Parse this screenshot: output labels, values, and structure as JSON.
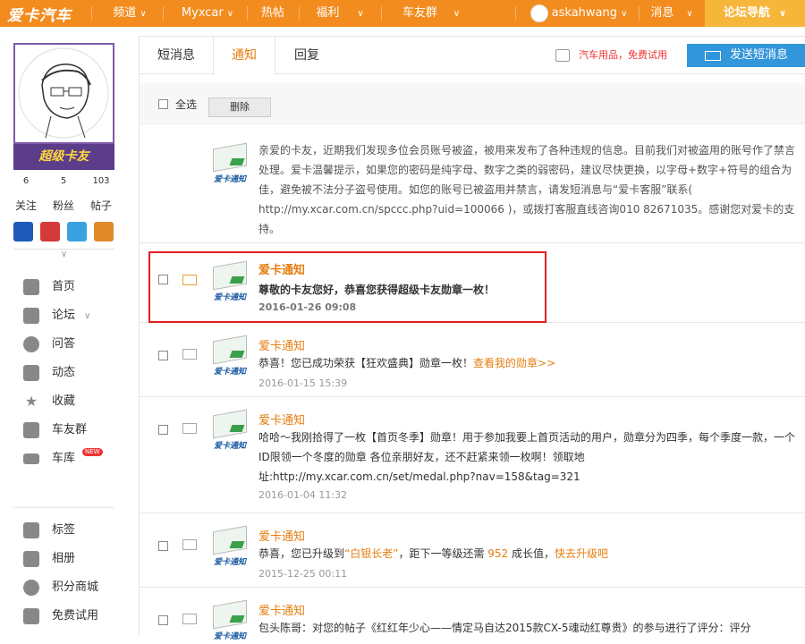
{
  "app": {
    "logo": "爱卡汽车"
  },
  "topnav": {
    "items": [
      {
        "label": "频道",
        "chev": "∨"
      },
      {
        "label": "Myxcar",
        "chev": "∨"
      },
      {
        "label": "热帖",
        "chev": ""
      },
      {
        "label": "福利",
        "chev": "∨"
      },
      {
        "label": "车友群",
        "chev": "∨"
      }
    ],
    "user": "askahwang",
    "user_chev": "∨",
    "messages": "消息",
    "messages_chev": "∨",
    "forum_nav": "论坛导航",
    "forum_nav_chev": "∨"
  },
  "profile": {
    "badge_text": "超级卡友",
    "stats": [
      {
        "value": "6",
        "label": "关注"
      },
      {
        "value": "5",
        "label": "粉丝"
      },
      {
        "value": "103",
        "label": "帖子"
      }
    ]
  },
  "sidebar": {
    "items": [
      {
        "label": "首页",
        "icon": "home-icon"
      },
      {
        "label": "论坛",
        "icon": "forum-icon",
        "sub": "∨"
      },
      {
        "label": "问答",
        "icon": "question-icon"
      },
      {
        "label": "动态",
        "icon": "activity-icon"
      },
      {
        "label": "收藏",
        "icon": "star-icon"
      },
      {
        "label": "车友群",
        "icon": "group-icon"
      },
      {
        "label": "车库",
        "icon": "car-icon",
        "badge": "NEW"
      },
      {
        "label": "标签",
        "icon": "tag-icon"
      },
      {
        "label": "相册",
        "icon": "camera-icon"
      },
      {
        "label": "积分商城",
        "icon": "coin-icon"
      },
      {
        "label": "免费试用",
        "icon": "gift-icon"
      }
    ]
  },
  "tabs": [
    {
      "label": "短消息"
    },
    {
      "label": "通知",
      "active": true
    },
    {
      "label": "回复"
    }
  ],
  "promo": "汽车用品，免费试用",
  "send_button": "发送短消息",
  "toolbar": {
    "select_all": "全选",
    "delete": "删除"
  },
  "messages": [
    {
      "sender": "",
      "icon_label": "爱卡通知",
      "text": "亲爱的卡友，近期我们发现多位会员账号被盗，被用来发布了各种违规的信息。目前我们对被盗用的账号作了禁言处理。爱卡温馨提示，如果您的密码是纯字母、数字之类的弱密码，建议尽快更换，以字母+数字+符号的组合为佳，避免被不法分子盗号使用。如您的账号已被盗用并禁言，请发短消息与“爱卡客服”联系( http://my.xcar.com.cn/spccc.php?uid=100066 )，或拨打客服直线咨询010 82671035。感谢您对爱卡的支持。",
      "date": "",
      "highlight": ""
    },
    {
      "sender": "爱卡通知",
      "icon_label": "爱卡通知",
      "text": "尊敬的卡友您好，恭喜您获得超级卡友勋章一枚！",
      "date": "2016-01-26 09:08",
      "highlight": ""
    },
    {
      "sender": "爱卡通知",
      "icon_label": "爱卡通知",
      "text": "恭喜！您已成功荣获【狂欢盛典】勋章一枚！",
      "highlight": "查看我的勋章>>",
      "date": "2016-01-15 15:39"
    },
    {
      "sender": "爱卡通知",
      "icon_label": "爱卡通知",
      "text": "哈哈～我刚拾得了一枚【首页冬季】勋章！用于参加我要上首页活动的用户，勋章分为四季，每个季度一款，一个ID限领一个冬度的勋章 各位亲朋好友，还不赶紧来领一枚啊！领取地址:http://my.xcar.com.cn/set/medal.php?nav=158&tag=321",
      "date": "2016-01-04 11:32",
      "highlight": ""
    },
    {
      "sender": "爱卡通知",
      "icon_label": "爱卡通知",
      "text_parts": [
        "恭喜，您已升级到",
        "“白银长老”",
        "，距下一等级还需 ",
        "952",
        " 成长值，",
        "快去升级吧"
      ],
      "date": "2015-12-25 00:11"
    },
    {
      "sender": "爱卡通知",
      "icon_label": "爱卡通知",
      "text": "包头陈哥：对您的帖子《红红年少心——情定马自达2015款CX-5魂动红尊贵》的参与进行了评分：评分",
      "date": "",
      "highlight": ""
    }
  ]
}
